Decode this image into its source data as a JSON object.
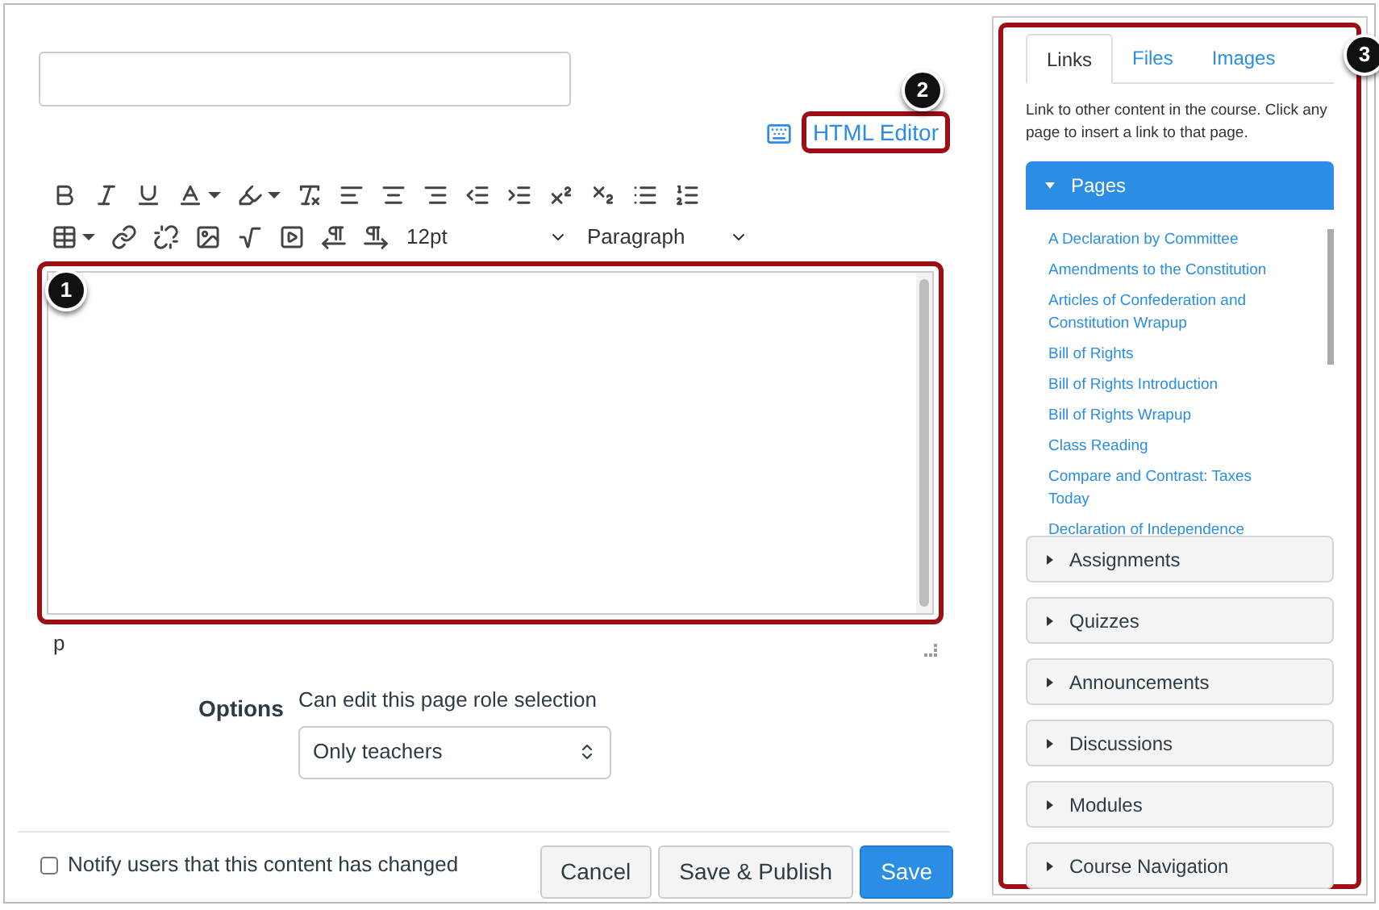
{
  "html_editor": {
    "label": "HTML Editor",
    "callout": "2"
  },
  "toolbar": {
    "font_size": "12pt",
    "block_format": "Paragraph"
  },
  "editor": {
    "callout": "1",
    "path": "p"
  },
  "options": {
    "label": "Options",
    "field_label": "Can edit this page role selection",
    "value": "Only teachers"
  },
  "notify": {
    "label": "Notify users that this content has changed",
    "checked": false
  },
  "buttons": [
    {
      "label": "Cancel",
      "kind": "default"
    },
    {
      "label": "Save & Publish",
      "kind": "default"
    },
    {
      "label": "Save",
      "kind": "primary"
    }
  ],
  "sidebar": {
    "callout": "3",
    "tabs": [
      {
        "label": "Links",
        "selected": true
      },
      {
        "label": "Files",
        "selected": false
      },
      {
        "label": "Images",
        "selected": false
      }
    ],
    "description": "Link to other content in the course. Click any page to insert a link to that page.",
    "sections": [
      {
        "label": "Pages",
        "expanded": true,
        "items": [
          "A Declaration by Committee",
          "Amendments to the Constitution",
          "Articles of Confederation and Constitution Wrapup",
          "Bill of Rights",
          "Bill of Rights Introduction",
          "Bill of Rights Wrapup",
          "Class Reading",
          "Compare and Contrast: Taxes Today",
          "Declaration of Independence"
        ]
      },
      {
        "label": "Assignments",
        "expanded": false
      },
      {
        "label": "Quizzes",
        "expanded": false
      },
      {
        "label": "Announcements",
        "expanded": false
      },
      {
        "label": "Discussions",
        "expanded": false
      },
      {
        "label": "Modules",
        "expanded": false
      },
      {
        "label": "Course Navigation",
        "expanded": false
      }
    ]
  }
}
